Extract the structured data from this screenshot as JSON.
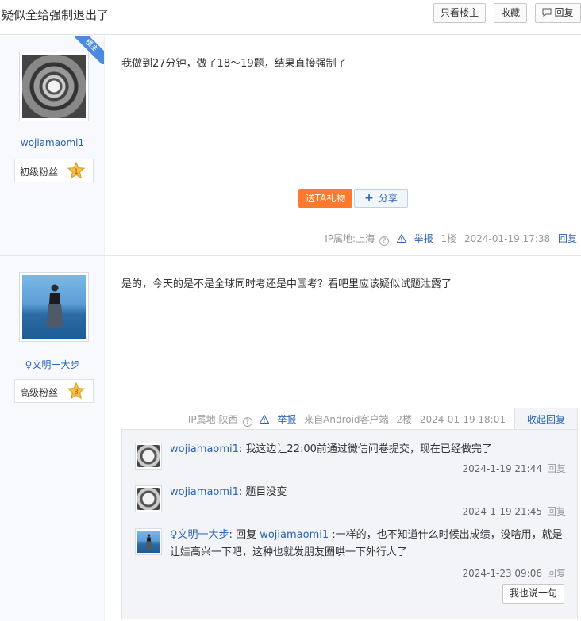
{
  "header": {
    "title": "疑似全给强制退出了",
    "only_op_label": "只看楼主",
    "favorite_label": "收藏",
    "reply_label": "回复"
  },
  "posts": [
    {
      "username": "wojiamaomi1",
      "fan_level": "初级粉丝",
      "fan_badge_number": "1",
      "op_badge": "楼主",
      "content": "我做到27分钟，做了18～19题，结果直接强制了",
      "gift_label": "送TA礼物",
      "share_label": "分享",
      "ip": "IP属地:上海",
      "report_label": "举报",
      "floor": "1楼",
      "time": "2024-01-19 17:38",
      "reply_link": "回复"
    },
    {
      "username": "文明一大步",
      "fan_level": "高级粉丝",
      "fan_badge_number": "3",
      "content": "是的，今天的是不是全球同时考还是中国考？看吧里应该疑似试题泄露了",
      "ip": "IP属地:陕西",
      "report_label": "举报",
      "client": "来自Android客户端",
      "floor": "2楼",
      "time": "2024-01-19 18:01",
      "collapse_label": "收起回复",
      "replies": [
        {
          "name": "wojiamaomi1",
          "text": "我这边让22:00前通过微信问卷提交，现在已经做完了",
          "time": "2024-1-19 21:44",
          "reply_link": "回复"
        },
        {
          "name": "wojiamaomi1",
          "text": "题目没变",
          "time": "2024-1-19 21:45",
          "reply_link": "回复"
        },
        {
          "name": "文明一大步",
          "reply_prefix": "回复",
          "reply_to": "wojiamaomi1",
          "text": ":一样的，也不知道什么时候出成绩，没啥用，就是让娃高兴一下吧，这种也就发朋友圈哄一下外行人了",
          "time": "2024-1-23 09:06",
          "reply_link": "回复"
        }
      ],
      "say_label": "我也说一句"
    }
  ],
  "colors": {
    "link": "#2d64b3",
    "gift": "#ff7a2d",
    "badge_gold": "#f5c04a",
    "op_badge": "#4a8be0"
  }
}
